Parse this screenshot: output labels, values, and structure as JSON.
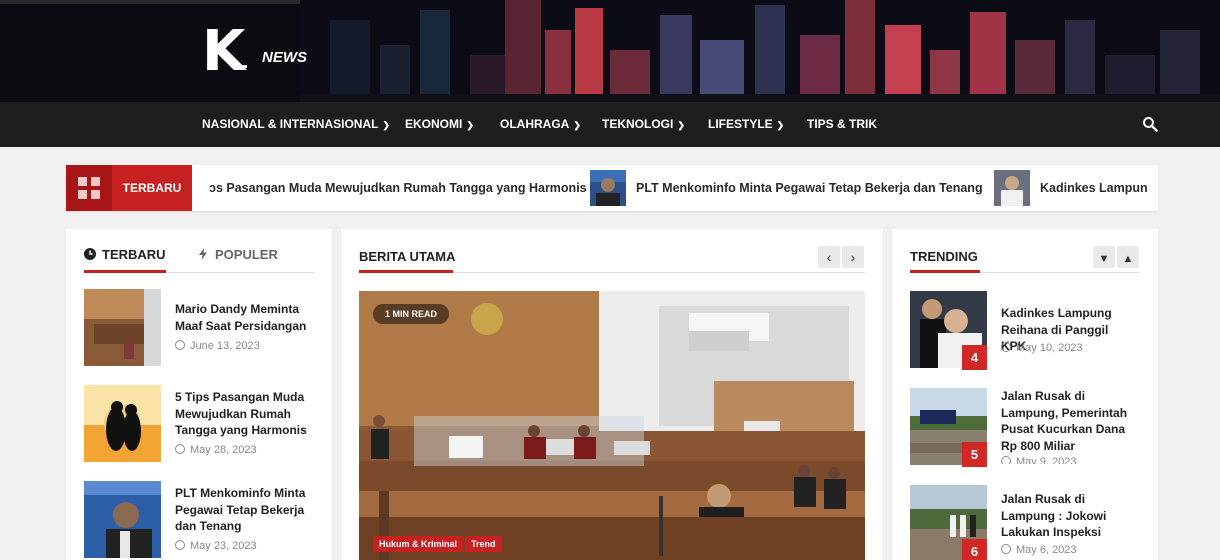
{
  "colors": {
    "accent": "#c62020",
    "nav_bg": "#1e1e1e",
    "header_bg": "#0b0b12"
  },
  "logo": {
    "k": "K",
    "dash": "-",
    "news": "NEWS"
  },
  "nav": {
    "items": [
      {
        "label": "NASIONAL & INTERNASIONAL",
        "has_dropdown": true
      },
      {
        "label": "EKONOMI",
        "has_dropdown": true
      },
      {
        "label": "OLAHRAGA",
        "has_dropdown": true
      },
      {
        "label": "TEKNOLOGI",
        "has_dropdown": true
      },
      {
        "label": "LIFESTYLE",
        "has_dropdown": true
      },
      {
        "label": "TIPS & TRIK",
        "has_dropdown": false
      }
    ],
    "search_icon": "search-icon"
  },
  "ticker": {
    "label": "TERBARU",
    "items": [
      {
        "title": "ɔs Pasangan Muda Mewujudkan Rumah Tangga yang Harmonis"
      },
      {
        "title": "PLT Menkominfo Minta Pegawai Tetap Bekerja dan Tenang"
      },
      {
        "title": "Kadinkes Lampun"
      }
    ]
  },
  "left": {
    "tabs": [
      {
        "label": "TERBARU",
        "icon": "clock-icon"
      },
      {
        "label": "POPULER",
        "icon": "bolt-icon"
      }
    ],
    "posts": [
      {
        "title": "Mario Dandy Meminta Maaf Saat Persidangan",
        "date": "June 13, 2023"
      },
      {
        "title": "5 Tips Pasangan Muda Mewujudkan Rumah Tangga yang Harmonis",
        "date": "May 28, 2023"
      },
      {
        "title": "PLT Menkominfo Minta Pegawai Tetap Bekerja dan Tenang",
        "date": "May 23, 2023"
      }
    ]
  },
  "main": {
    "title": "BERITA UTAMA",
    "read_time": "1 MIN READ",
    "categories": [
      "Hukum & Kriminal",
      "Trend"
    ]
  },
  "trending": {
    "title": "TRENDING",
    "posts": [
      {
        "rank": "4",
        "title": "Kadinkes Lampung Reihana di Panggil KPK",
        "date": "May 10, 2023"
      },
      {
        "rank": "5",
        "title": "Jalan Rusak di Lampung, Pemerintah Pusat Kucurkan Dana Rp 800 Miliar",
        "date": "May 9, 2023"
      },
      {
        "rank": "6",
        "title": "Jalan Rusak di Lampung : Jokowi Lakukan Inspeksi",
        "date": "May 6, 2023"
      }
    ]
  }
}
